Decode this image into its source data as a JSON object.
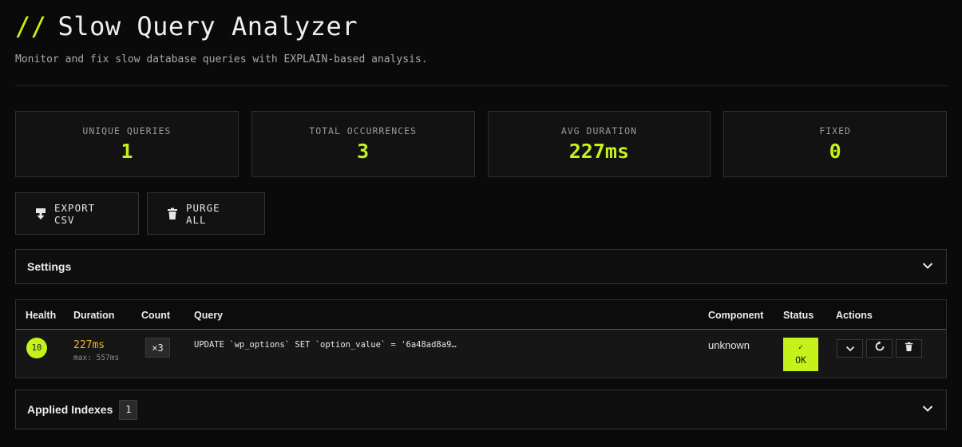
{
  "header": {
    "slashes": "//",
    "title": "Slow Query Analyzer",
    "subtitle": "Monitor and fix slow database queries with EXPLAIN-based analysis."
  },
  "stats": [
    {
      "label": "UNIQUE QUERIES",
      "value": "1"
    },
    {
      "label": "TOTAL OCCURRENCES",
      "value": "3"
    },
    {
      "label": "AVG DURATION",
      "value": "227ms"
    },
    {
      "label": "FIXED",
      "value": "0"
    }
  ],
  "toolbar": {
    "export_label": "EXPORT CSV",
    "export_icon": "download-icon",
    "purge_label": "PURGE ALL",
    "purge_icon": "trash-icon"
  },
  "settings_panel": {
    "title": "Settings",
    "icon": "chevron-down-icon"
  },
  "table": {
    "columns": [
      "Health",
      "Duration",
      "Count",
      "Query",
      "Component",
      "Status",
      "Actions"
    ],
    "rows": [
      {
        "health": "10",
        "duration": "227ms",
        "max": "max: 557ms",
        "count": "×3",
        "query": "UPDATE `wp_options` SET `option_value` = '6a48ad8a9…",
        "component": "unknown",
        "status_check": "✓",
        "status": "OK",
        "actions": [
          "chevron-down-icon",
          "refresh-icon",
          "trash-icon"
        ]
      }
    ]
  },
  "indexes_panel": {
    "title": "Applied Indexes",
    "count": "1",
    "icon": "chevron-down-icon"
  },
  "colors": {
    "accent": "#c6f21c",
    "duration": "#f0b429",
    "background": "#0a0a0a"
  }
}
